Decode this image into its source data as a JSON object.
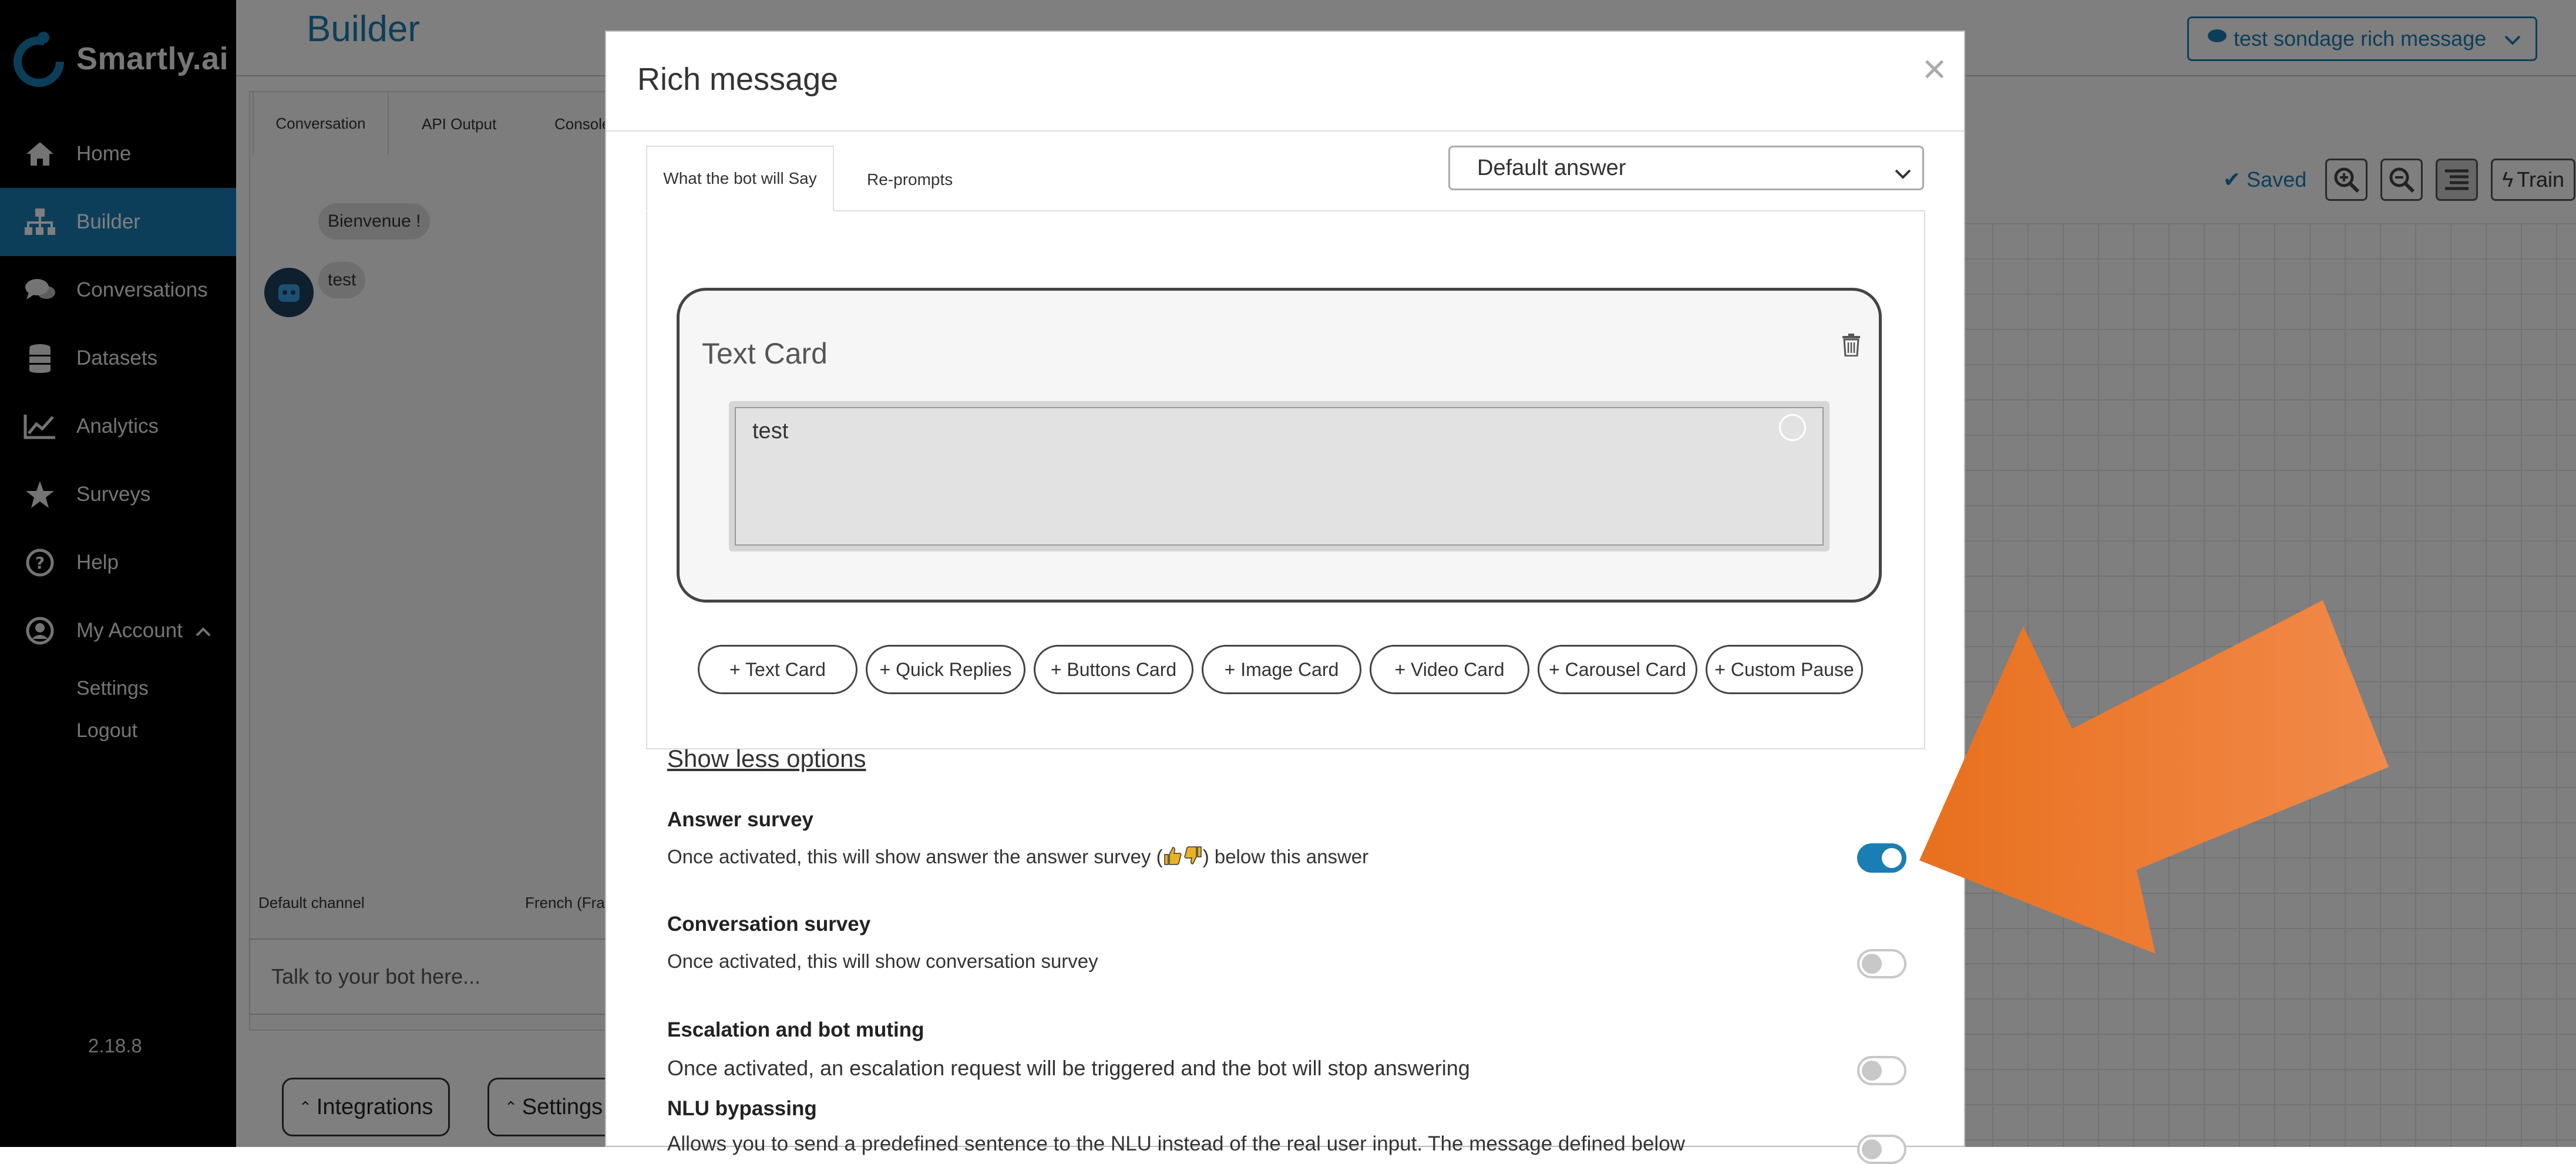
{
  "sidebar": {
    "brand": "Smartly.ai",
    "items": [
      {
        "label": "Home",
        "icon": "home-icon"
      },
      {
        "label": "Builder",
        "icon": "sitemap-icon"
      },
      {
        "label": "Conversations",
        "icon": "chat-bubbles-icon"
      },
      {
        "label": "Datasets",
        "icon": "database-icon"
      },
      {
        "label": "Analytics",
        "icon": "line-chart-icon"
      },
      {
        "label": "Surveys",
        "icon": "star-icon"
      },
      {
        "label": "Help",
        "icon": "question-circle-icon"
      },
      {
        "label": "My Account",
        "icon": "user-circle-icon"
      }
    ],
    "sub_items": [
      "Settings",
      "Logout"
    ],
    "version": "2.18.8",
    "accent_color": "#1a7db3"
  },
  "main": {
    "title": "Builder",
    "bot_select": "test sondage rich message",
    "tabs": [
      "Conversation",
      "API Output",
      "Console"
    ],
    "chat": [
      "Bienvenue !",
      "test"
    ],
    "footer_left": "Default channel",
    "footer_right": "French (Fran",
    "talk_placeholder": "Talk to your bot here...",
    "bottom_buttons": [
      "Integrations",
      "Settings"
    ],
    "saved_label": "Saved",
    "train_label": "Train"
  },
  "modal": {
    "title": "Rich message",
    "close": "×",
    "tabs": [
      "What the bot will Say",
      "Re-prompts"
    ],
    "answer_select": "Default answer",
    "text_card": {
      "title": "Text Card",
      "value": "test"
    },
    "add_buttons": [
      "+ Text Card",
      "+ Quick Replies",
      "+ Buttons Card",
      "+ Image Card",
      "+ Video Card",
      "+ Carousel Card",
      "+ Custom Pause"
    ],
    "show_less": "Show less options",
    "options": [
      {
        "title": "Answer survey",
        "desc_before": "Once activated, this will show answer the answer survey (",
        "desc_after": ") below this answer",
        "enabled": true
      },
      {
        "title": "Conversation survey",
        "desc": "Once activated, this will show conversation survey",
        "enabled": false
      },
      {
        "title": "Escalation and bot muting",
        "desc": "Once activated, an escalation request will be triggered and the bot will stop answering",
        "enabled": false
      },
      {
        "title": "NLU bypassing",
        "desc": "Allows you to send a predefined sentence to the NLU instead of the real user input. The message defined below",
        "enabled": false
      }
    ]
  },
  "annotation": {
    "arrow_color": "#f07a2a"
  }
}
